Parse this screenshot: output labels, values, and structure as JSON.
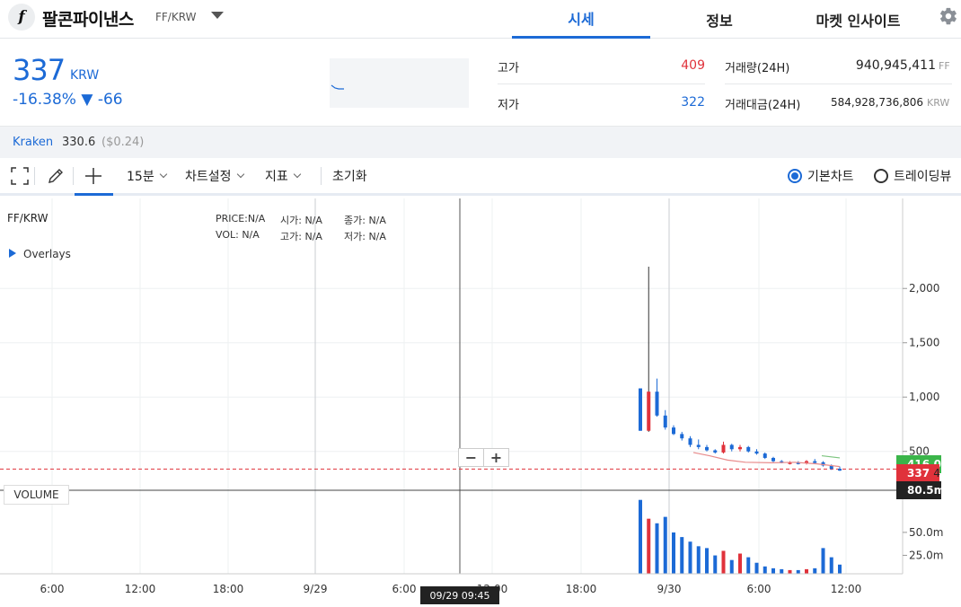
{
  "header": {
    "logo_letter": "f",
    "coin_name": "팔콘파이낸스",
    "pair": "FF/KRW",
    "tabs": [
      {
        "label": "시세",
        "active": true
      },
      {
        "label": "정보",
        "active": false
      },
      {
        "label": "마켓 인사이트",
        "active": false
      }
    ]
  },
  "summary": {
    "price": "337",
    "unit": "KRW",
    "change_percent": "-16.38%",
    "change_amount": "▼ -66",
    "stats": [
      {
        "label": "고가",
        "value": "409",
        "color": "#e0323b"
      },
      {
        "label": "저가",
        "value": "322",
        "color": "#1c6ad6"
      },
      {
        "label": "거래량(24H)",
        "value": "940,945,411",
        "unit": "FF"
      },
      {
        "label": "거래대금(24H)",
        "value": "584,928,736,806",
        "unit": "KRW"
      }
    ]
  },
  "exchange": {
    "name": "Kraken",
    "price": "330.6",
    "usd": "($0.24)"
  },
  "toolbar": {
    "interval": "15분",
    "chart_settings": "차트설정",
    "indicators": "지표",
    "reset": "초기화",
    "view_basic": "기본차트",
    "view_tradingview": "트레이딩뷰"
  },
  "chart": {
    "symbol": "FF/KRW",
    "ohlc_labels": {
      "price": "PRICE:N/A",
      "open": "시가: N/A",
      "close": "종가: N/A",
      "vol": "VOL: N/A",
      "high": "고가: N/A",
      "low": "저가: N/A"
    },
    "overlays_label": "Overlays",
    "volume_label": "VOLUME",
    "y_ticks": [
      "2,000",
      "1,500",
      "1,000",
      "500"
    ],
    "vol_ticks": [
      "50.0m",
      "25.0m"
    ],
    "x_ticks": [
      "6:00",
      "12:00",
      "18:00",
      "9/29",
      "6:00",
      "12:00",
      "18:00",
      "9/30",
      "6:00",
      "12:00"
    ],
    "crosshair_time": "09/29 09:45",
    "current_price_tag": "337",
    "current_price_tag_suffix": "4",
    "green_tag": "416.0",
    "volume_tag": "80.5m",
    "zoom_out": "−",
    "zoom_in": "+",
    "colors": {
      "up": "#e0323b",
      "down": "#1c6ad6",
      "accent": "#1c6ad6"
    }
  },
  "chart_data": {
    "type": "candlestick",
    "title": "",
    "ylim": [
      0,
      2300
    ],
    "volume_ylim": [
      0,
      90
    ],
    "candles": [
      {
        "t": "9/29 21:30",
        "o": 1080,
        "h": 1080,
        "l": 690,
        "c": 690
      },
      {
        "t": "9/29 21:45",
        "o": 690,
        "h": 2200,
        "l": 680,
        "c": 1050
      },
      {
        "t": "9/29 22:00",
        "o": 1050,
        "h": 1170,
        "l": 820,
        "c": 830
      },
      {
        "t": "9/29 22:15",
        "o": 830,
        "h": 880,
        "l": 700,
        "c": 720
      },
      {
        "t": "9/29 22:30",
        "o": 720,
        "h": 740,
        "l": 650,
        "c": 660
      },
      {
        "t": "9/29 22:45",
        "o": 660,
        "h": 680,
        "l": 600,
        "c": 620
      },
      {
        "t": "9/29 23:00",
        "o": 620,
        "h": 640,
        "l": 540,
        "c": 560
      },
      {
        "t": "9/29 23:15",
        "o": 560,
        "h": 610,
        "l": 520,
        "c": 540
      },
      {
        "t": "9/29 23:30",
        "o": 540,
        "h": 560,
        "l": 500,
        "c": 510
      },
      {
        "t": "9/29 23:45",
        "o": 510,
        "h": 520,
        "l": 480,
        "c": 490
      },
      {
        "t": "9/30 00:00",
        "o": 490,
        "h": 590,
        "l": 480,
        "c": 560
      },
      {
        "t": "9/30 00:30",
        "o": 560,
        "h": 570,
        "l": 500,
        "c": 520
      },
      {
        "t": "9/30 01:00",
        "o": 520,
        "h": 560,
        "l": 500,
        "c": 540
      },
      {
        "t": "9/30 01:30",
        "o": 540,
        "h": 550,
        "l": 490,
        "c": 500
      },
      {
        "t": "9/30 02:00",
        "o": 500,
        "h": 520,
        "l": 470,
        "c": 480
      },
      {
        "t": "9/30 03:00",
        "o": 480,
        "h": 490,
        "l": 430,
        "c": 440
      },
      {
        "t": "9/30 04:00",
        "o": 440,
        "h": 450,
        "l": 400,
        "c": 410
      },
      {
        "t": "9/30 05:00",
        "o": 410,
        "h": 420,
        "l": 390,
        "c": 395
      },
      {
        "t": "9/30 06:00",
        "o": 395,
        "h": 410,
        "l": 380,
        "c": 400
      },
      {
        "t": "9/30 07:00",
        "o": 400,
        "h": 410,
        "l": 380,
        "c": 390
      },
      {
        "t": "9/30 08:00",
        "o": 390,
        "h": 420,
        "l": 380,
        "c": 410
      },
      {
        "t": "9/30 09:00",
        "o": 410,
        "h": 430,
        "l": 390,
        "c": 400
      },
      {
        "t": "9/30 10:00",
        "o": 400,
        "h": 410,
        "l": 360,
        "c": 370
      },
      {
        "t": "9/30 11:00",
        "o": 370,
        "h": 380,
        "l": 330,
        "c": 340
      },
      {
        "t": "9/30 11:30",
        "o": 340,
        "h": 360,
        "l": 320,
        "c": 337
      }
    ],
    "volume": [
      80.5,
      60,
      55,
      62,
      45,
      40,
      35,
      30,
      28,
      20,
      25,
      15,
      22,
      18,
      12,
      8,
      6,
      5,
      4,
      4,
      5,
      6,
      28,
      18,
      10
    ]
  }
}
